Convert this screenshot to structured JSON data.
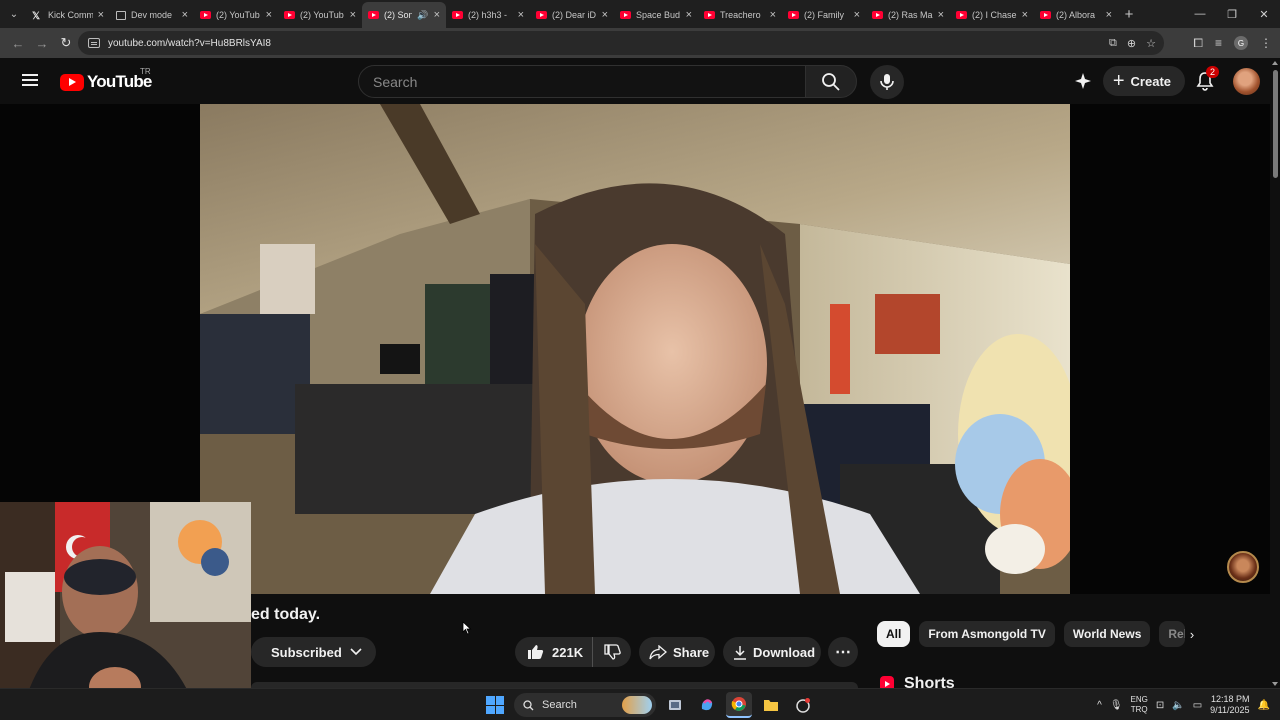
{
  "browser": {
    "tabs": [
      {
        "title": "Kick Comm",
        "icon": "x-icon",
        "active": false
      },
      {
        "title": "Dev mode",
        "icon": "devmode-icon",
        "active": false
      },
      {
        "title": "(2) YouTub",
        "icon": "youtube-icon",
        "active": false
      },
      {
        "title": "(2) YouTub",
        "icon": "youtube-icon",
        "active": false
      },
      {
        "title": "(2) Son",
        "icon": "youtube-icon",
        "active": true,
        "audio": true
      },
      {
        "title": "(2) h3h3 -",
        "icon": "youtube-icon",
        "active": false
      },
      {
        "title": "(2) Dear iD",
        "icon": "youtube-icon",
        "active": false
      },
      {
        "title": "Space Bud",
        "icon": "youtube-icon",
        "active": false
      },
      {
        "title": "Treachero",
        "icon": "youtube-icon",
        "active": false
      },
      {
        "title": "(2) Family",
        "icon": "youtube-icon",
        "active": false
      },
      {
        "title": "(2) Ras Ma",
        "icon": "youtube-icon",
        "active": false
      },
      {
        "title": "(2) I Chase",
        "icon": "youtube-icon",
        "active": false
      },
      {
        "title": "(2) Albora",
        "icon": "youtube-icon",
        "active": false
      }
    ],
    "url": "youtube.com/watch?v=Hu8BRlsYAI8",
    "profile_initial": "G"
  },
  "youtube": {
    "logo_text": "YouTube",
    "country_code": "TR",
    "search_placeholder": "Search",
    "create_label": "Create",
    "notification_count": "2",
    "video_title_visible": "ed today.",
    "subscribed_label": "Subscribed",
    "like_count": "221K",
    "share_label": "Share",
    "download_label": "Download",
    "chips": [
      "All",
      "From Asmongold TV",
      "World News",
      "Rel"
    ],
    "shorts_label": "Shorts"
  },
  "taskbar": {
    "search_label": "Search",
    "language_line1": "ENG",
    "language_line2": "TRQ",
    "time": "12:18 PM",
    "date": "9/11/2025"
  },
  "colors": {
    "youtube_red": "#ff0000",
    "background": "#0f0f0f",
    "chip_bg": "#272727",
    "chrome_toolbar": "#3c3c3c"
  }
}
